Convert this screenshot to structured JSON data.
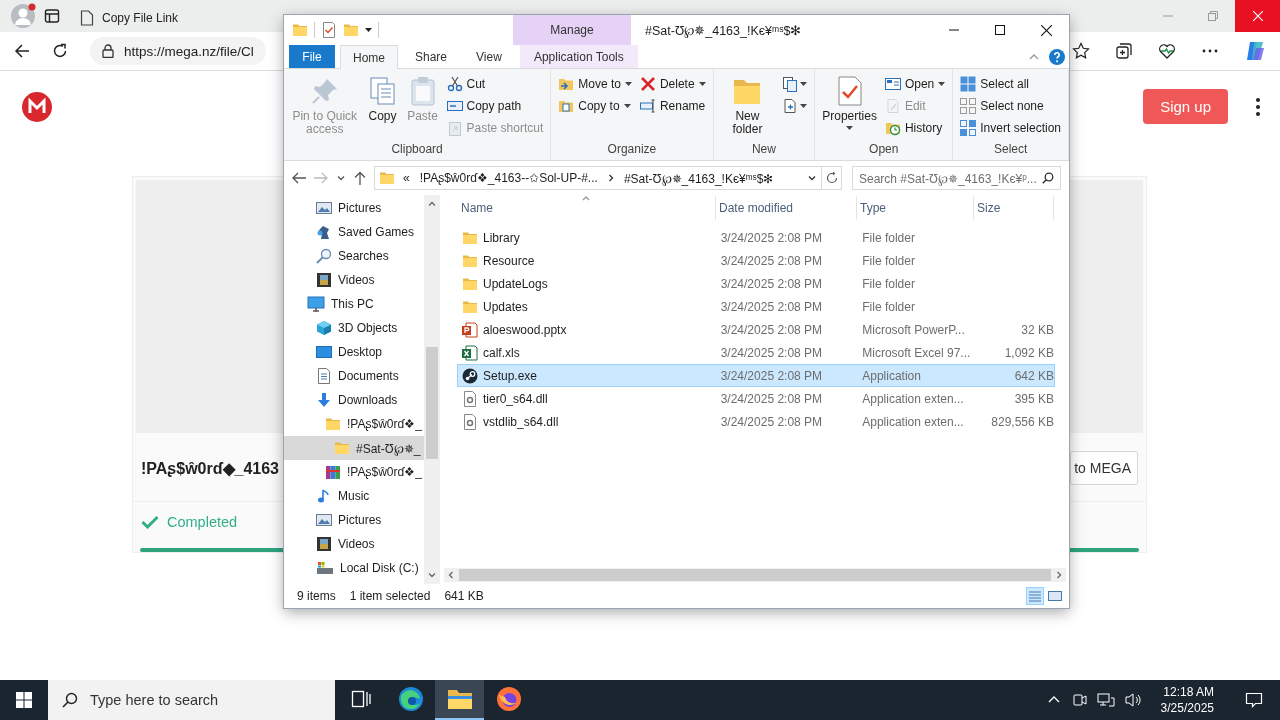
{
  "browser": {
    "tabs": [
      {
        "label": "Copy File Link",
        "selected": false
      }
    ],
    "address": "https://mega.nz/file/Cl",
    "page": {
      "sign_up": "Sign up",
      "file_name": "!PAʂ$ŵ0rɗ◆_4163",
      "action_button": "to MEGA",
      "status": "Completed",
      "level": 1
    }
  },
  "explorer": {
    "context_header": "Manage",
    "title": "#Sat-Ʊ℘✵_4163_!Kє¥ᵐˢ$✻",
    "ribbon_tabs": [
      {
        "label": "File",
        "kind": "file",
        "selected": false
      },
      {
        "label": "Home",
        "kind": "tab",
        "selected": true
      },
      {
        "label": "Share",
        "kind": "tab",
        "selected": false
      },
      {
        "label": "View",
        "kind": "tab",
        "selected": false
      },
      {
        "label": "Application Tools",
        "kind": "context",
        "selected": false
      }
    ],
    "groups": [
      {
        "label": "Clipboard",
        "columns": [
          [
            {
              "label": "Pin to Quick access",
              "kind": "large",
              "disabled": true,
              "dropdown": false
            }
          ],
          [
            {
              "label": "Copy",
              "kind": "large",
              "disabled": false,
              "dropdown": false
            }
          ],
          [
            {
              "label": "Paste",
              "kind": "large",
              "disabled": true,
              "dropdown": false
            }
          ],
          [
            {
              "label": "Cut",
              "kind": "small",
              "disabled": false,
              "dropdown": false
            },
            {
              "label": "Copy path",
              "kind": "small",
              "disabled": false,
              "dropdown": false
            },
            {
              "label": "Paste shortcut",
              "kind": "small",
              "disabled": true,
              "dropdown": false
            }
          ]
        ]
      },
      {
        "label": "Organize",
        "columns": [
          [
            {
              "label": "Move to",
              "kind": "small",
              "disabled": false,
              "dropdown": true
            },
            {
              "label": "Copy to",
              "kind": "small",
              "disabled": false,
              "dropdown": true
            }
          ],
          [
            {
              "label": "Delete",
              "kind": "small",
              "disabled": false,
              "dropdown": true
            },
            {
              "label": "Rename",
              "kind": "small",
              "disabled": false,
              "dropdown": false
            }
          ]
        ]
      },
      {
        "label": "New",
        "columns": [
          [
            {
              "label": "New folder",
              "kind": "large",
              "disabled": false,
              "dropdown": false
            }
          ],
          [
            {
              "kind": "icon",
              "disabled": false,
              "dropdown": true
            },
            {
              "kind": "icon",
              "disabled": false,
              "dropdown": true
            }
          ]
        ]
      },
      {
        "label": "Open",
        "columns": [
          [
            {
              "label": "Properties",
              "kind": "large",
              "disabled": false,
              "dropdown": true
            }
          ],
          [
            {
              "label": "Open",
              "kind": "small",
              "disabled": false,
              "dropdown": true
            },
            {
              "label": "Edit",
              "kind": "small",
              "disabled": true,
              "dropdown": false
            },
            {
              "label": "History",
              "kind": "small",
              "disabled": false,
              "dropdown": false
            }
          ]
        ]
      },
      {
        "label": "Select",
        "columns": [
          [
            {
              "label": "Select all",
              "kind": "small",
              "disabled": false,
              "dropdown": false
            },
            {
              "label": "Select none",
              "kind": "small",
              "disabled": false,
              "dropdown": false
            },
            {
              "label": "Invert selection",
              "kind": "small",
              "disabled": false,
              "dropdown": false
            }
          ]
        ]
      }
    ],
    "path": {
      "overflow": "«",
      "crumbs": [
        "!PAʂ$ŵ0rɗ❖_4163--✩Sol-UP-#...",
        "#Sat-Ʊ℘✵_4163_!Kє¥ᵐˢ$✻"
      ]
    },
    "search": {
      "placeholder": "Search #Sat-Ʊ℘✵_4163_!Kє¥ᵖ..."
    },
    "tree": [
      {
        "children": [
          {
            "label": "Pictures",
            "kind": "pictures",
            "selected": false
          },
          {
            "label": "Saved Games",
            "kind": "games",
            "selected": false
          },
          {
            "label": "Searches",
            "kind": "search",
            "selected": false
          },
          {
            "label": "Videos",
            "kind": "videos",
            "selected": false
          }
        ]
      },
      {
        "label": "This PC",
        "kind": "pc",
        "selected": false,
        "children": [
          {
            "label": "3D Objects",
            "kind": "objects",
            "selected": false
          },
          {
            "label": "Desktop",
            "kind": "desktop",
            "selected": false
          },
          {
            "label": "Documents",
            "kind": "documents",
            "selected": false
          },
          {
            "label": "Downloads",
            "kind": "downloads",
            "selected": false,
            "children": [
              {
                "label": "!PAʂ$ŵ0rɗ❖_",
                "kind": "folder",
                "selected": false,
                "children": [
                  {
                    "label": "#Sat-Ʊ℘✵_",
                    "kind": "folder",
                    "selected": true
                  }
                ]
              },
              {
                "label": "!PAʂ$ŵ0rɗ❖_",
                "kind": "archive",
                "selected": false
              }
            ]
          },
          {
            "label": "Music",
            "kind": "music",
            "selected": false
          },
          {
            "label": "Pictures",
            "kind": "pictures",
            "selected": false
          },
          {
            "label": "Videos",
            "kind": "videos",
            "selected": false
          },
          {
            "label": "Local Disk (C:)",
            "kind": "disk",
            "selected": false
          }
        ]
      }
    ],
    "columns": [
      "Name",
      "Date modified",
      "Type",
      "Size"
    ],
    "rows": [
      {
        "name": "Library",
        "date": "3/24/2025 2:08 PM",
        "type": "File folder",
        "kind": "folder",
        "selected": false
      },
      {
        "name": "Resource",
        "date": "3/24/2025 2:08 PM",
        "type": "File folder",
        "kind": "folder",
        "selected": false
      },
      {
        "name": "UpdateLogs",
        "date": "3/24/2025 2:08 PM",
        "type": "File folder",
        "kind": "folder",
        "selected": false
      },
      {
        "name": "Updates",
        "date": "3/24/2025 2:08 PM",
        "type": "File folder",
        "kind": "folder",
        "selected": false
      },
      {
        "name": "aloeswood.pptx",
        "date": "3/24/2025 2:08 PM",
        "type": "Microsoft PowerP...",
        "size": "32 KB",
        "kind": "pptx",
        "selected": false
      },
      {
        "name": "calf.xls",
        "date": "3/24/2025 2:08 PM",
        "type": "Microsoft Excel 97...",
        "size": "1,092 KB",
        "kind": "xls",
        "selected": false
      },
      {
        "name": "Setup.exe",
        "date": "3/24/2025 2:08 PM",
        "type": "Application",
        "size": "642 KB",
        "kind": "exe",
        "selected": true
      },
      {
        "name": "tier0_s64.dll",
        "date": "3/24/2025 2:08 PM",
        "type": "Application exten...",
        "size": "395 KB",
        "kind": "dll",
        "selected": false
      },
      {
        "name": "vstdlib_s64.dll",
        "date": "3/24/2025 2:08 PM",
        "type": "Application exten...",
        "size": "829,556 KB",
        "kind": "dll",
        "selected": false
      }
    ],
    "status": [
      "9 items",
      "1 item selected",
      "641 KB"
    ]
  },
  "taskbar": {
    "search_placeholder": "Type here to search",
    "apps": [
      {
        "kind": "taskview",
        "selected": false
      },
      {
        "kind": "edge",
        "selected": false
      },
      {
        "kind": "explorer",
        "selected": true
      },
      {
        "kind": "firefox",
        "selected": false
      }
    ],
    "time": "12:18 AM",
    "date": "3/25/2025"
  }
}
